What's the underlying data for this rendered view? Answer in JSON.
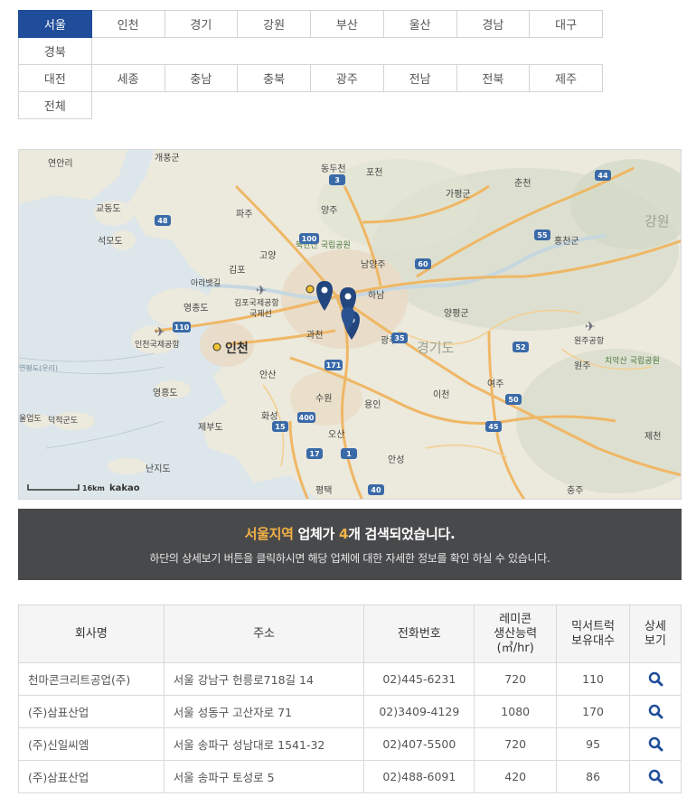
{
  "regions": {
    "row1": [
      "서울",
      "인천",
      "경기",
      "강원",
      "부산",
      "울산",
      "경남",
      "대구"
    ],
    "row2": [
      "경북"
    ],
    "row3": [
      "대전",
      "세종",
      "충남",
      "충북",
      "광주",
      "전남",
      "전북",
      "제주"
    ],
    "row4": [
      "전체"
    ],
    "active": "서울"
  },
  "map": {
    "provider": "kakao",
    "scale_label": "16km",
    "places": [
      "연안리",
      "개풍군",
      "동두천",
      "포천",
      "가평군",
      "춘천",
      "교동도",
      "파주",
      "양주",
      "강원",
      "석모도",
      "고양",
      "홍천군",
      "북한산 국립공원",
      "남양주",
      "김포",
      "아라뱃길",
      "김포국제공항",
      "국제선",
      "하남",
      "영종도",
      "양평군",
      "인천국제공항",
      "인천",
      "과천",
      "광주",
      "경기도",
      "원주공항",
      "연평도(우리)",
      "안산",
      "여주",
      "원주",
      "치악산 국립공원",
      "영흥도",
      "수원",
      "용인",
      "이천",
      "덕적군도",
      "제부도",
      "화성",
      "오산",
      "제천",
      "난지도",
      "평택",
      "안성",
      "충주",
      "울업도"
    ],
    "road_numbers": [
      "3",
      "48",
      "44",
      "100",
      "60",
      "55",
      "35",
      "110",
      "171",
      "52",
      "50",
      "400",
      "15",
      "17",
      "1",
      "40",
      "45"
    ],
    "marker_count": 4
  },
  "banner": {
    "region_text": "서울지역",
    "line1_mid": " 업체가 ",
    "count": "4",
    "line1_end": "개 검색되었습니다.",
    "line2": "하단의 상세보기 버튼을 클릭하시면 해당 업체에 대한 자세한 정보를 확인 하실 수 있습니다."
  },
  "table": {
    "headers": {
      "name": "회사명",
      "address": "주소",
      "phone": "전화번호",
      "capacity_1": "레미콘",
      "capacity_2": "생산능력",
      "capacity_3": "(㎥/hr)",
      "trucks_1": "믹서트럭",
      "trucks_2": "보유대수",
      "detail_1": "상세",
      "detail_2": "보기"
    },
    "rows": [
      {
        "name": "천마콘크리트공업(주)",
        "address": "서울 강남구 헌릉로718길 14",
        "phone": "02)445-6231",
        "capacity": "720",
        "trucks": "110"
      },
      {
        "name": "(주)삼표산업",
        "address": "서울 성동구 고산자로 71",
        "phone": "02)3409-4129",
        "capacity": "1080",
        "trucks": "170"
      },
      {
        "name": "(주)신일씨엠",
        "address": "서울 송파구 성남대로 1541-32",
        "phone": "02)407-5500",
        "capacity": "720",
        "trucks": "95"
      },
      {
        "name": "(주)삼표산업",
        "address": "서울 송파구 토성로 5",
        "phone": "02)488-6091",
        "capacity": "420",
        "trucks": "86"
      }
    ]
  },
  "colors": {
    "active_tab": "#1f4d99",
    "banner_bg": "#48494b",
    "banner_accent": "#f2b246",
    "marker": "#24467e",
    "search_icon": "#1f4d99"
  }
}
